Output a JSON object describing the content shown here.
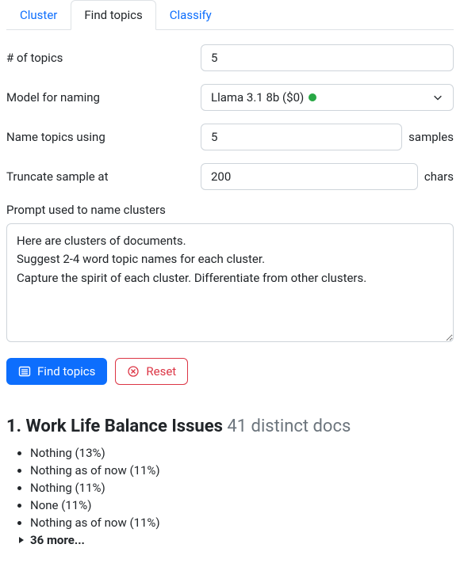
{
  "tabs": [
    {
      "label": "Cluster",
      "active": false
    },
    {
      "label": "Find topics",
      "active": true
    },
    {
      "label": "Classify",
      "active": false
    }
  ],
  "form": {
    "num_topics": {
      "label": "# of topics",
      "value": "5"
    },
    "model": {
      "label": "Model for naming",
      "selected": "Llama 3.1 8b ($0)",
      "status_color": "#28a745"
    },
    "name_using": {
      "label": "Name topics using",
      "value": "5",
      "suffix": "samples"
    },
    "truncate": {
      "label": "Truncate sample at",
      "value": "200",
      "suffix": "chars"
    },
    "prompt": {
      "label": "Prompt used to name clusters",
      "value": "Here are clusters of documents.\nSuggest 2-4 word topic names for each cluster.\nCapture the spirit of each cluster. Differentiate from other clusters."
    }
  },
  "buttons": {
    "find": "Find topics",
    "reset": "Reset"
  },
  "result": {
    "index": "1.",
    "title": "Work Life Balance Issues",
    "sub": "41 distinct docs",
    "docs": [
      "Nothing (13%)",
      "Nothing as of now (11%)",
      "Nothing (11%)",
      "None (11%)",
      "Nothing as of now (11%)"
    ],
    "more": "36 more..."
  }
}
